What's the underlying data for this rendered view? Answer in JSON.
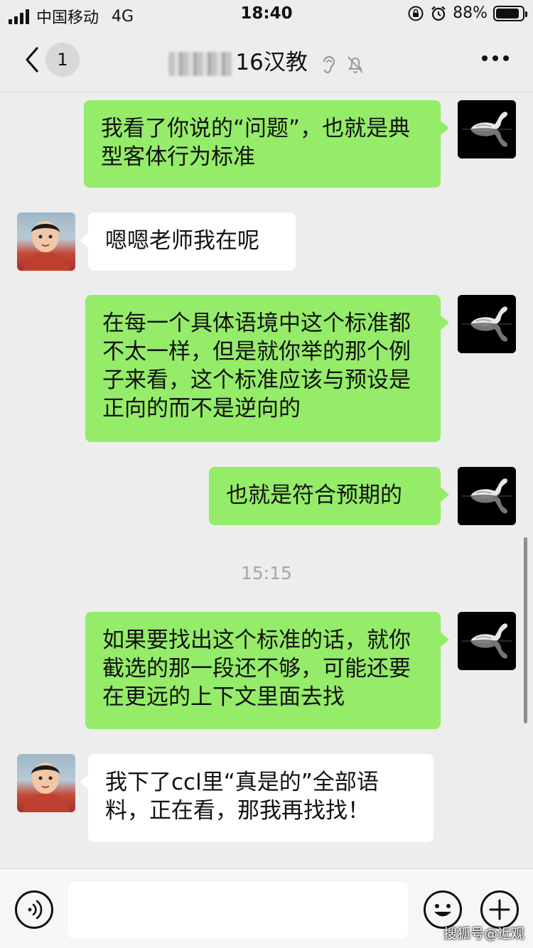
{
  "status_bar": {
    "carrier": "中国移动",
    "network": "4G",
    "time": "18:40",
    "battery_text": "88%",
    "battery_level": 0.88
  },
  "nav": {
    "unread_count": "1",
    "title_suffix": "16汉教"
  },
  "messages": [
    {
      "text": "我看了你说的“问题”，也就是典型客体行为标准"
    },
    {
      "text": "嗯嗯老师我在呢"
    },
    {
      "text": "在每一个具体语境中这个标准都不太一样，但是就你举的那个例子来看，这个标准应该与预设是正向的而不是逆向的"
    },
    {
      "text": "也就是符合预期的"
    },
    {
      "time": "15:15"
    },
    {
      "text": "如果要找出这个标准的话，就你截选的那一段还不够，可能还要在更远的上下文里面去找"
    },
    {
      "text": "我下了ccl里“真是的”全部语料，正在看，那我再找找！"
    }
  ],
  "input": {
    "value": ""
  },
  "watermark": "搜狐号@近观",
  "colors": {
    "outgoing_bubble": "#95ec69",
    "incoming_bubble": "#ffffff",
    "background": "#ededed"
  }
}
